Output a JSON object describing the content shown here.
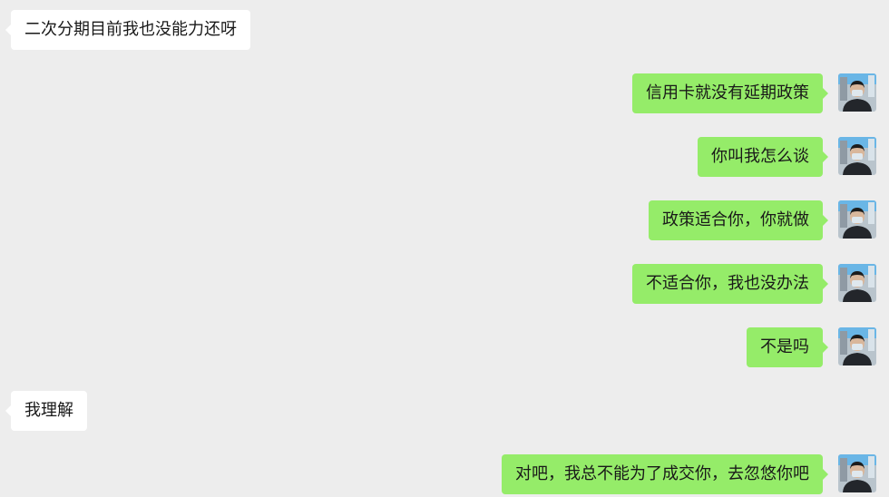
{
  "messages": [
    {
      "side": "in",
      "text": "二次分期目前我也没能力还呀"
    },
    {
      "side": "out",
      "text": "信用卡就没有延期政策"
    },
    {
      "side": "out",
      "text": "你叫我怎么谈"
    },
    {
      "side": "out",
      "text": "政策适合你，你就做"
    },
    {
      "side": "out",
      "text": "不适合你，我也没办法"
    },
    {
      "side": "out",
      "text": "不是吗"
    },
    {
      "side": "in",
      "text": "我理解"
    },
    {
      "side": "out",
      "text": "对吧，我总不能为了成交你，去忽悠你吧"
    }
  ],
  "colors": {
    "background": "#ededed",
    "incoming_bubble": "#ffffff",
    "outgoing_bubble": "#95ec69",
    "text": "#191919"
  }
}
